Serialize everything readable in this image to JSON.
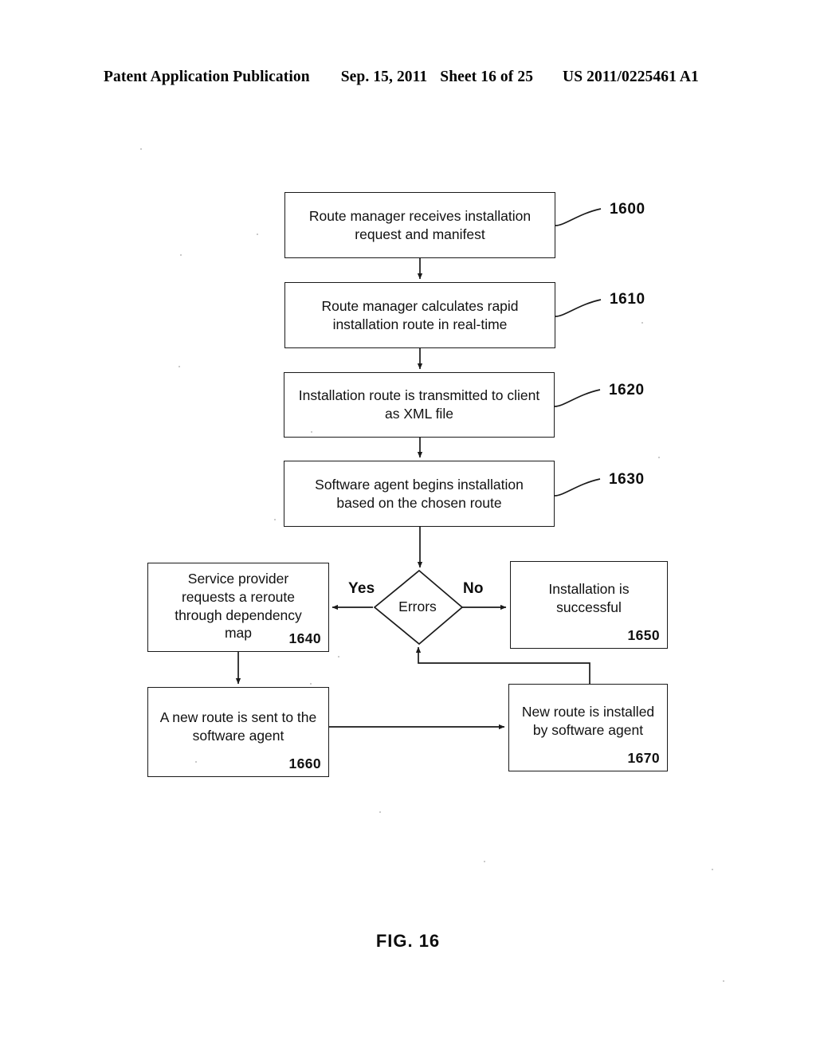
{
  "header": {
    "publication": "Patent Application Publication",
    "date": "Sep. 15, 2011",
    "sheet": "Sheet 16 of 25",
    "patent_number": "US 2011/0225461 A1"
  },
  "figure": {
    "caption": "FIG. 16",
    "type": "flowchart"
  },
  "nodes": {
    "n1600": {
      "text_line1": "Route manager receives installation",
      "text_line2": "request and manifest",
      "ref": "1600",
      "shape": "process"
    },
    "n1610": {
      "text_line1": "Route manager calculates rapid",
      "text_line2": "installation route in real-time",
      "ref": "1610",
      "shape": "process"
    },
    "n1620": {
      "text_line1": "Installation route is transmitted to client",
      "text_line2": "as XML file",
      "ref": "1620",
      "shape": "process"
    },
    "n1630": {
      "text_line1": "Software agent begins installation",
      "text_line2": "based on the chosen route",
      "ref": "1630",
      "shape": "process"
    },
    "n1640": {
      "text_line1": "Service provider",
      "text_line2": "requests a reroute",
      "text_line3": "through dependency",
      "text_line4": "map",
      "ref": "1640",
      "shape": "process"
    },
    "decision": {
      "text": "Errors",
      "shape": "decision"
    },
    "n1650": {
      "text_line1": "Installation is",
      "text_line2": "successful",
      "ref": "1650",
      "shape": "process"
    },
    "n1660": {
      "text_line1": "A new route is sent to the",
      "text_line2": "software agent",
      "ref": "1660",
      "shape": "process"
    },
    "n1670": {
      "text_line1": "New route is installed",
      "text_line2": "by software agent",
      "ref": "1670",
      "shape": "process"
    }
  },
  "edges": {
    "yes_label": "Yes",
    "no_label": "No"
  },
  "colors": {
    "stroke": "#1a1a1a",
    "text": "#111111",
    "background": "#ffffff"
  }
}
